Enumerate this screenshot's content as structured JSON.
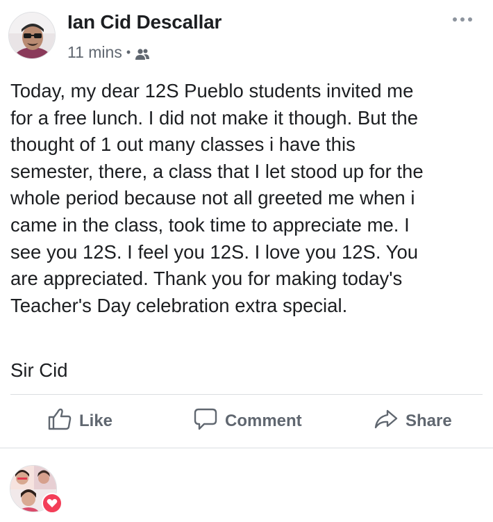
{
  "post": {
    "author": {
      "name": "Ian Cid Descallar"
    },
    "time": "11 mins",
    "separator": "•",
    "audience_icon": "friends-icon",
    "more_icon": "more-icon",
    "body": "Today, my dear 12S Pueblo students invited me\nfor a free lunch. I did not make it though. But the\nthought of 1 out many classes i have this\nsemester, there, a class that I let stood up for the\nwhole period because not all greeted me when i\ncame in the class, took time to appreciate me. I\nsee you 12S. I feel you 12S. I love you 12S. You\nare appreciated. Thank you for making today's\nTeacher's Day celebration extra special.",
    "signature": "Sir Cid"
  },
  "actions": {
    "like": {
      "label": "Like",
      "icon": "thumbs-up-icon"
    },
    "comment": {
      "label": "Comment",
      "icon": "comment-bubble-icon"
    },
    "share": {
      "label": "Share",
      "icon": "share-arrow-icon"
    }
  },
  "comment_section": {
    "reaction_icon": "heart-icon"
  },
  "colors": {
    "text_primary": "#1c1e21",
    "text_secondary": "#606770",
    "divider": "#dadde1",
    "reaction_love": "#f33e58"
  }
}
